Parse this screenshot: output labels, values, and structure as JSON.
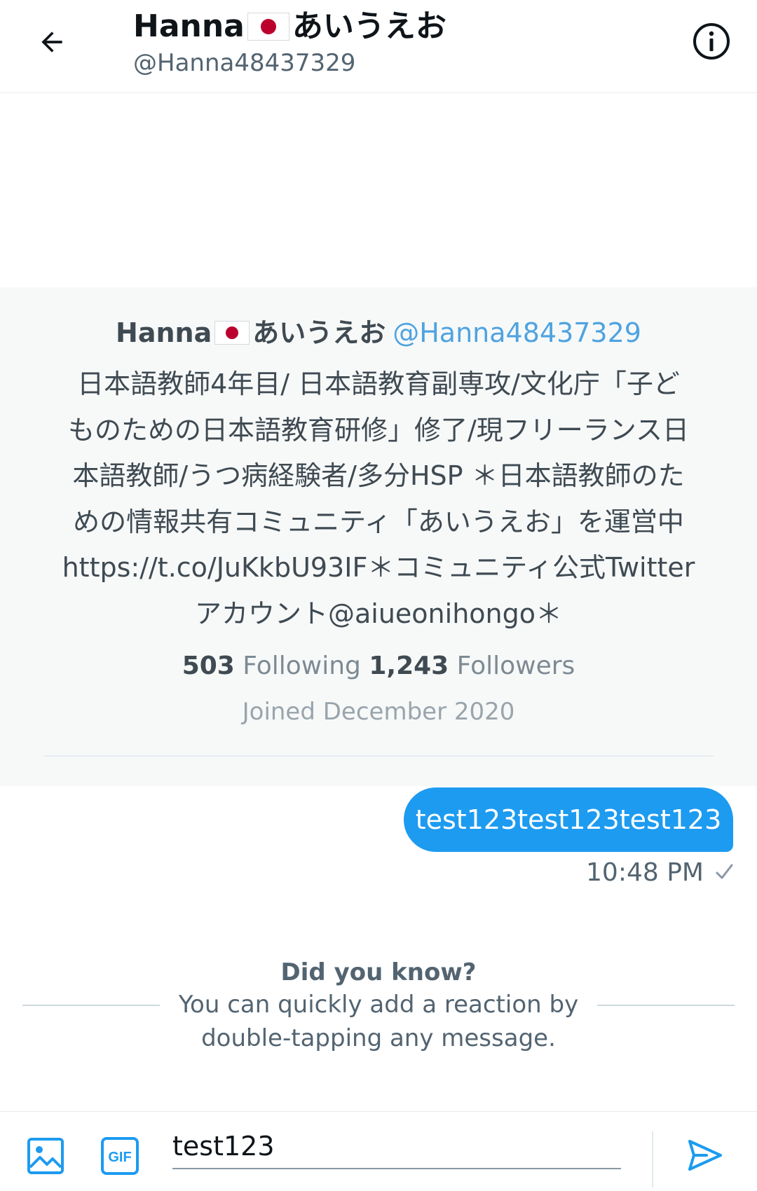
{
  "header": {
    "name_prefix": "Hanna",
    "name_suffix": "あいうえお",
    "handle": "@Hanna48437329"
  },
  "profile": {
    "name_prefix": "Hanna",
    "name_suffix": "あいうえお",
    "handle": "@Hanna48437329",
    "bio_lines": [
      "日本語教師4年目/ 日本語教育副専攻/文化庁「子ど",
      "ものための日本語教育研修」修了/現フリーランス日",
      "本語教師/うつ病経験者/多分HSP ＊日本語教師のた",
      "めの情報共有コミュニティ「あいうえお」を運営中",
      "https://t.co/JuKkbU93IF＊コミュニティ公式Twitter",
      "アカウント@aiueonihongo＊"
    ],
    "following_count": "503",
    "following_label": "Following",
    "followers_count": "1,243",
    "followers_label": "Followers",
    "joined": "Joined December 2020"
  },
  "message": {
    "text": "test123test123test123",
    "time": "10:48 PM"
  },
  "tip": {
    "title": "Did you know?",
    "body": "You can quickly add a reaction by double-tapping any message."
  },
  "composer": {
    "value": "test123"
  },
  "colors": {
    "accent": "#1d9bf0",
    "card_background": "#f7f9f9",
    "handle_link": "#4fa3e0"
  },
  "icons": {
    "back": "arrow-left-icon",
    "info": "info-icon",
    "media": "image-icon",
    "gif": "gif-icon",
    "send": "send-icon",
    "status": "check-icon",
    "flag": "japan-flag-icon"
  }
}
